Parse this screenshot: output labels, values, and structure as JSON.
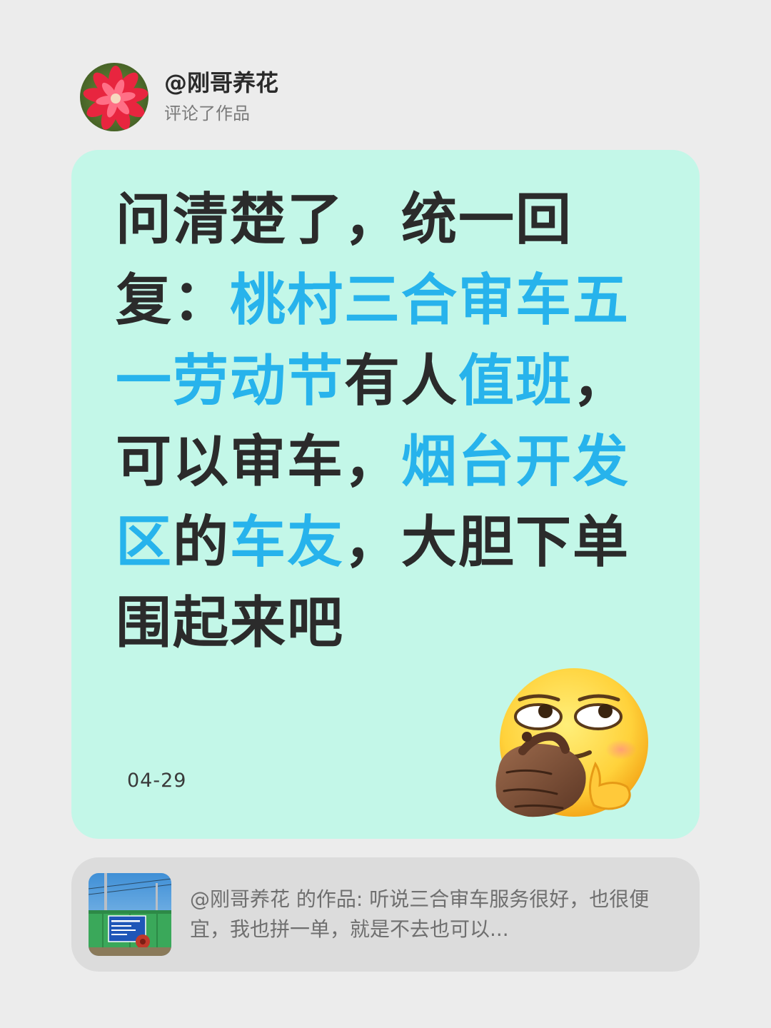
{
  "author": {
    "username": "@刚哥养花",
    "action_text": "评论了作品",
    "avatar_icon": "red-flower-avatar"
  },
  "comment": {
    "segments": [
      {
        "text": "问清楚了，统一回复：",
        "highlight": false
      },
      {
        "text": "桃村三合审车五一劳动节",
        "highlight": true
      },
      {
        "text": "有人",
        "highlight": false
      },
      {
        "text": "值班",
        "highlight": true
      },
      {
        "text": "，可以审车，",
        "highlight": false
      },
      {
        "text": "烟台开发区",
        "highlight": true
      },
      {
        "text": "的",
        "highlight": false
      },
      {
        "text": "车友",
        "highlight": true
      },
      {
        "text": "，大胆下单围起来吧",
        "highlight": false
      }
    ],
    "date": "04-29",
    "sticker_icon": "thinking-smirk-emoji",
    "colors": {
      "text": "#2b2b2b",
      "highlight": "#27b3ec",
      "card_background": "#c3f7e8"
    }
  },
  "quoted_work": {
    "text": "@刚哥养花  的作品: 听说三合审车服务很好，也很便宜，我也拼一单，就是不去也可以...",
    "thumbnail_icon": "roadside-sign-photo"
  }
}
